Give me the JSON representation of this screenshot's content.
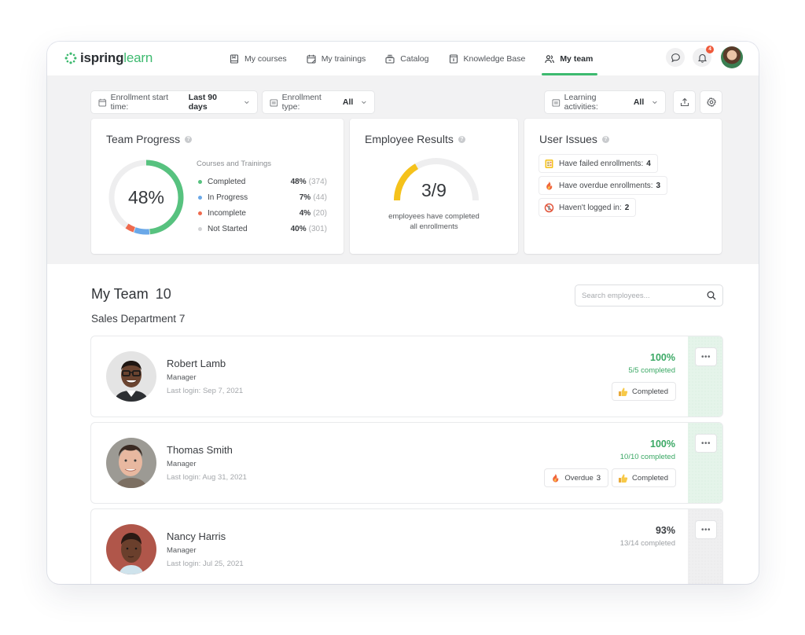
{
  "brand": {
    "logo_prefix": "ispring",
    "logo_suffix": "learn",
    "accent": "#3dba6f"
  },
  "nav": {
    "items": [
      {
        "label": "My courses",
        "icon": "book-icon",
        "active": false
      },
      {
        "label": "My trainings",
        "icon": "calendar-icon",
        "active": false
      },
      {
        "label": "Catalog",
        "icon": "catalog-icon",
        "active": false
      },
      {
        "label": "Knowledge Base",
        "icon": "info-book-icon",
        "active": false
      },
      {
        "label": "My team",
        "icon": "team-icon",
        "active": true
      }
    ],
    "notifications_count": "4"
  },
  "filters": {
    "enrollment_start": {
      "label": "Enrollment start time:",
      "value": "Last 90 days"
    },
    "enrollment_type": {
      "label": "Enrollment type:",
      "value": "All"
    },
    "learning_activities": {
      "label": "Learning activities:",
      "value": "All"
    }
  },
  "team_progress": {
    "title": "Team Progress",
    "center_label": "48%",
    "legend_title": "Courses and Trainings",
    "items": [
      {
        "label": "Completed",
        "percent": "48%",
        "count": "(374)",
        "value": 48,
        "color": "#57c27f"
      },
      {
        "label": "In Progress",
        "percent": "7%",
        "count": "(44)",
        "value": 7,
        "color": "#6aa8e8"
      },
      {
        "label": "Incomplete",
        "percent": "4%",
        "count": "(20)",
        "value": 4,
        "color": "#ef6a4e"
      },
      {
        "label": "Not Started",
        "percent": "40%",
        "count": "(301)",
        "value": 40,
        "color": "#d2d3d5"
      }
    ],
    "track_color": "#eeeeef"
  },
  "employee_results": {
    "title": "Employee Results",
    "value_label": "3/9",
    "completed": 3,
    "total": 9,
    "caption_line1": "employees have completed",
    "caption_line2": "all enrollments",
    "fill_color": "#f5c21b",
    "track_color": "#eeeeef"
  },
  "user_issues": {
    "title": "User Issues",
    "items": [
      {
        "label": "Have failed enrollments:",
        "count": "4",
        "icon": "failed-checklist-icon"
      },
      {
        "label": "Have overdue enrollments:",
        "count": "3",
        "icon": "fire-icon"
      },
      {
        "label": "Haven't logged in:",
        "count": "2",
        "icon": "prohibited-icon"
      }
    ]
  },
  "team": {
    "title": "My Team",
    "count": "10",
    "search_placeholder": "Search employees...",
    "department": {
      "name": "Sales Department",
      "count": "7"
    },
    "employees": [
      {
        "name": "Robert Lamb",
        "role": "Manager",
        "last_login": "Last login: Sep 7, 2021",
        "percent": "100%",
        "completed": "5/5 completed",
        "status": "green",
        "tags": [
          {
            "label": "Completed",
            "count": "",
            "icon": "thumbs-up-icon"
          }
        ]
      },
      {
        "name": "Thomas Smith",
        "role": "Manager",
        "last_login": "Last login: Aug 31, 2021",
        "percent": "100%",
        "completed": "10/10 completed",
        "status": "green",
        "tags": [
          {
            "label": "Overdue",
            "count": "3",
            "icon": "fire-icon"
          },
          {
            "label": "Completed",
            "count": "",
            "icon": "thumbs-up-icon"
          }
        ]
      },
      {
        "name": "Nancy Harris",
        "role": "Manager",
        "last_login": "Last login: Jul 25, 2021",
        "percent": "93%",
        "completed": "13/14 completed",
        "status": "grey",
        "tags": []
      }
    ],
    "more_label": "•••"
  }
}
